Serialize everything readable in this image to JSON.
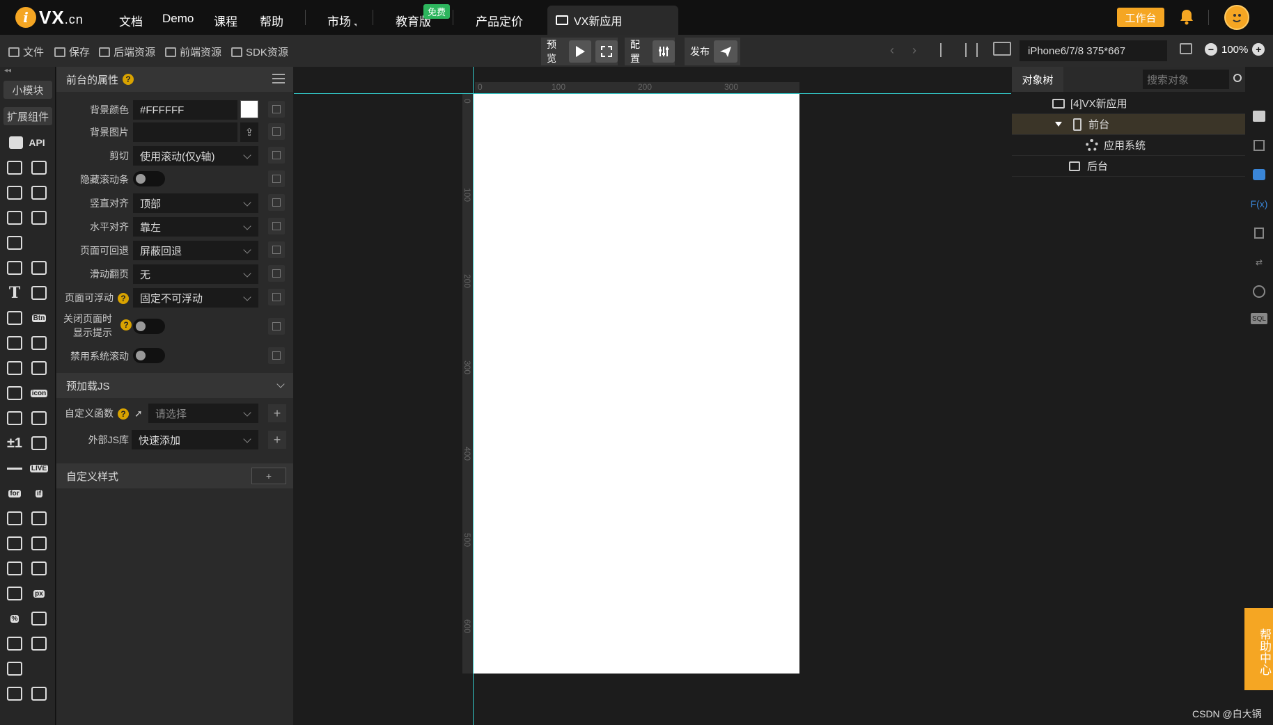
{
  "topbar": {
    "logo_text": "VX",
    "logo_suffix": ".cn",
    "nav": [
      "文档",
      "Demo",
      "课程",
      "帮助",
      "市场",
      "教育版",
      "产品定价"
    ],
    "free_tag": "免费",
    "app_tab": "VX新应用",
    "workbench": "工作台"
  },
  "toolbar": {
    "file": "文件",
    "save": "保存",
    "backend": "后端资源",
    "frontend": "前端资源",
    "sdk": "SDK资源",
    "preview": "预览",
    "config": "配置",
    "publish": "发布",
    "device": "iPhone6/7/8 375*667",
    "zoom": "100%"
  },
  "leftbar": {
    "tab_small": "小模块",
    "tab_ext": "扩展组件",
    "api": "API",
    "icons": [
      "api-icon",
      "nodes-icon",
      "cloud-mqtt-icon",
      "gear-icon",
      "download-icon",
      "upload-icon",
      "layout-icon",
      "copy-device-icon",
      "image-icon",
      "gallery-icon",
      "text-icon",
      "translate-icon",
      "edit-icon",
      "btn-icon",
      "music-icon",
      "video-icon",
      "rich-text-icon",
      "article-icon",
      "browser-icon",
      "icon-icon",
      "component-icon",
      "link-icon",
      "plus-minus-icon",
      "qrcode-icon",
      "line-icon",
      "live-icon",
      "for-icon",
      "if-icon",
      "form-icon",
      "collapse-icon",
      "card-icon",
      "swipe-icon",
      "grid-icon",
      "progress-icon",
      "slider-icon",
      "px-icon",
      "percent-icon",
      "sort-icon",
      "table-icon",
      "tree-list-icon",
      "share-icon",
      "timer-icon",
      "hourglass-icon"
    ],
    "small_labels": [
      "Btn",
      "icon",
      "for",
      "if",
      "LIVE",
      "px",
      "%"
    ]
  },
  "props": {
    "title": "前台的属性",
    "rows": [
      {
        "label": "背景颜色",
        "value": "#FFFFFF"
      },
      {
        "label": "背景图片",
        "value": ""
      },
      {
        "label": "剪切",
        "value": "使用滚动(仅y轴)"
      },
      {
        "label": "隐藏滚动条",
        "value": ""
      },
      {
        "label": "竖直对齐",
        "value": "顶部"
      },
      {
        "label": "水平对齐",
        "value": "靠左"
      },
      {
        "label": "页面可回退",
        "value": "屏蔽回退"
      },
      {
        "label": "滑动翻页",
        "value": "无"
      },
      {
        "label": "页面可浮动",
        "value": "固定不可浮动"
      },
      {
        "label": "关闭页面时",
        "value": ""
      },
      {
        "label": "显示提示",
        "value": ""
      },
      {
        "label": "禁用系统滚动",
        "value": ""
      }
    ],
    "preload_title": "预加载JS",
    "custom_fn_label": "自定义函数",
    "custom_fn_placeholder": "请选择",
    "ext_js_label": "外部JS库",
    "ext_js_value": "快速添加",
    "custom_style_title": "自定义样式",
    "custom_style_btn": "+"
  },
  "ruler": {
    "top": [
      "0",
      "100",
      "200",
      "300"
    ],
    "left": [
      "0",
      "100",
      "200",
      "300",
      "400",
      "500",
      "600"
    ]
  },
  "tree": {
    "tab": "对象树",
    "search_placeholder": "搜索对象",
    "nodes": [
      "[4]VX新应用",
      "前台",
      "应用系统",
      "后台"
    ]
  },
  "rstrip": {
    "icons": [
      "info-icon",
      "settings-icon",
      "chat-icon",
      "fx-icon",
      "copy-icon",
      "swap-icon",
      "cc-icon",
      "sql-icon"
    ],
    "fx": "F(x)",
    "sql": "SQL"
  },
  "help_center": "帮助中心",
  "credit": "CSDN @白大锅",
  "colors": {
    "accent": "#f5a623",
    "guide": "#33cccc",
    "free": "#2db55d"
  }
}
